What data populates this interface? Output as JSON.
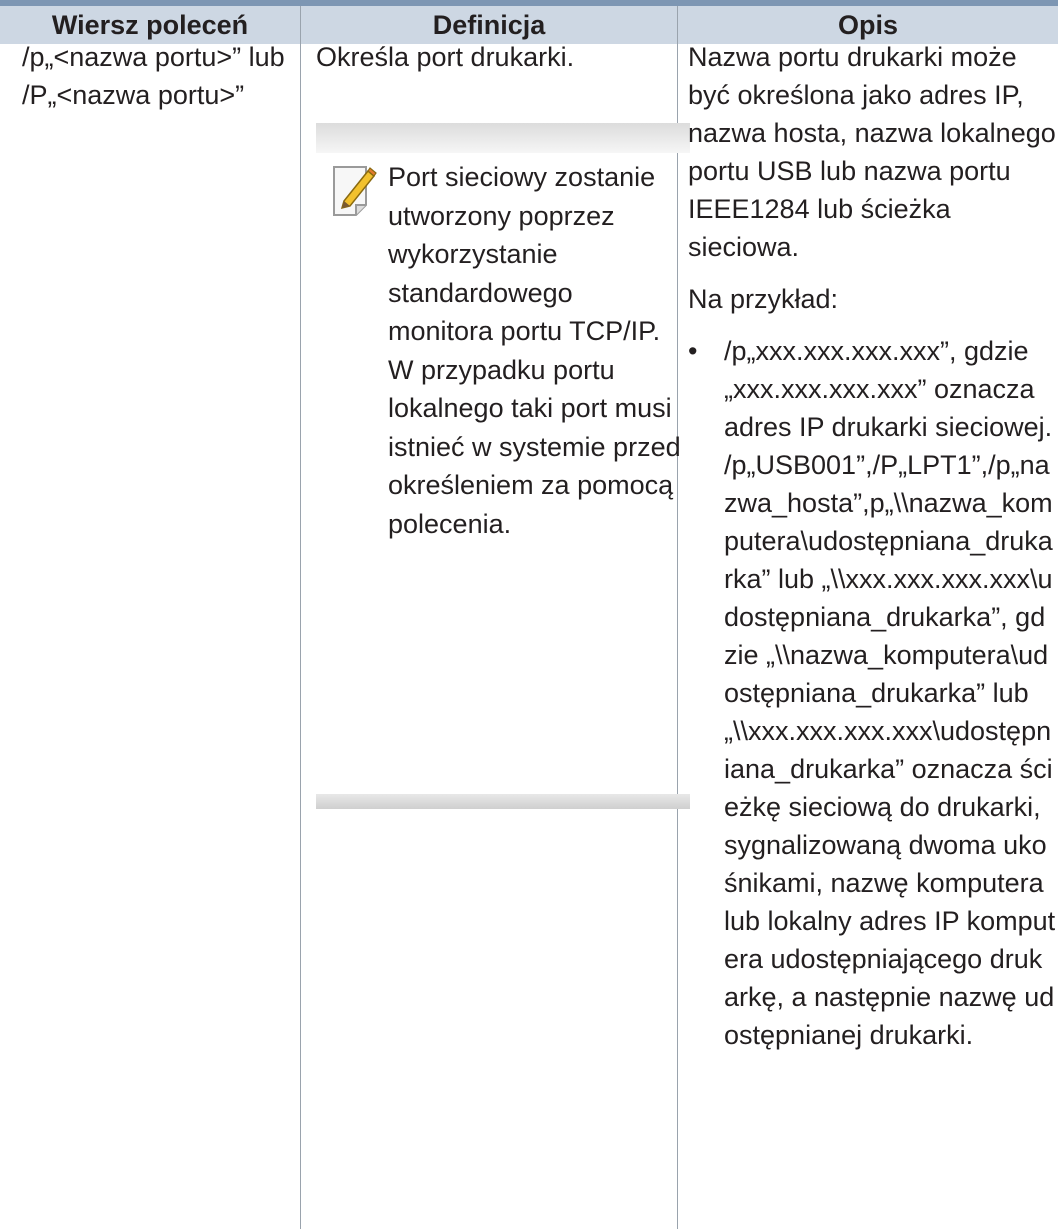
{
  "table": {
    "headers": [
      "Wiersz poleceń",
      "Definicja",
      "Opis"
    ],
    "row": {
      "command": "/p„<nazwa portu>” lub /P„<nazwa portu>”",
      "definition": "Określa port drukarki.",
      "note": "Port sieciowy zostanie utworzony poprzez wykorzystanie standardowego monitora portu TCP/IP. W przypadku portu lokalnego taki port musi istnieć w systemie przed określeniem za pomocą polecenia.",
      "description_p1": "Nazwa portu drukarki może być określona jako adres IP, nazwa hosta, nazwa lokalnego portu USB lub nazwa portu IEEE1284 lub ścieżka sieciowa.",
      "description_p2": "Na przykład:",
      "bullet_marker": "•",
      "bullet": "/p„xxx.xxx.xxx.xxx”, gdzie „xxx.xxx.xxx.xxx” oznacza adres IP drukarki sieciowej. /p„USB001”,/P„LPT1”,/p„nazwa_hosta”,p„\\\\nazwa_komputera\\udostępniana_drukarka” lub „\\\\xxx.xxx.xxx.xxx\\udostępniana_drukarka”, gdzie „\\\\nazwa_komputera\\udostępniana_drukarka” lub „\\\\xxx.xxx.xxx.xxx\\udostępniana_drukarka” oznacza ścieżkę sieciową do drukarki, sygnalizowaną dwoma ukośnikami, nazwę komputera lub lokalny adres IP komputera udostępniającego drukarkę, a następnie nazwę udostępnianej drukarki."
    }
  },
  "colors": {
    "header_bg": "#cdd7e3",
    "rule": "#7d96b3",
    "text": "#231f20"
  },
  "icons": {
    "note": "note-pencil-icon"
  }
}
